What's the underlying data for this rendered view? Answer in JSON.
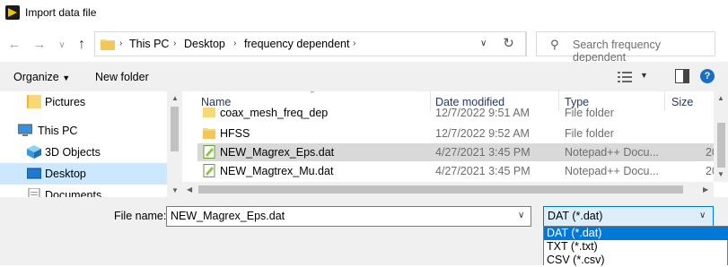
{
  "window": {
    "title": "Import data file"
  },
  "nav": {
    "breadcrumbs": [
      "This PC",
      "Desktop",
      "frequency dependent"
    ],
    "search_placeholder": "Search frequency dependent"
  },
  "toolbar": {
    "organize_label": "Organize",
    "new_folder_label": "New folder"
  },
  "sidebar": {
    "items": [
      {
        "label": "Pictures",
        "icon": "folder-icon"
      },
      {
        "label": "This PC",
        "icon": "computer-icon"
      },
      {
        "label": "3D Objects",
        "icon": "cube-icon"
      },
      {
        "label": "Desktop",
        "icon": "desktop-icon",
        "selected": true
      },
      {
        "label": "Documents",
        "icon": "documents-icon"
      }
    ]
  },
  "filelist": {
    "columns": [
      "Name",
      "Date modified",
      "Type",
      "Size"
    ],
    "rows": [
      {
        "name": "coax_mesh_freq_dep",
        "date": "12/7/2022 9:51 AM",
        "type": "File folder",
        "size": "",
        "icon": "folder-icon"
      },
      {
        "name": "HFSS",
        "date": "12/7/2022 9:52 AM",
        "type": "File folder",
        "size": "",
        "icon": "folder-icon"
      },
      {
        "name": "NEW_Magrex_Eps.dat",
        "date": "4/27/2021 3:45 PM",
        "type": "Notepad++ Docu...",
        "size": "20",
        "icon": "notepad-file-icon",
        "selected": true
      },
      {
        "name": "NEW_Magtrex_Mu.dat",
        "date": "4/27/2021 3:45 PM",
        "type": "Notepad++ Docu...",
        "size": "20",
        "icon": "notepad-file-icon"
      }
    ]
  },
  "bottom": {
    "file_name_label": "File name:",
    "file_name_value": "NEW_Magrex_Eps.dat",
    "file_type_value": "DAT (*.dat)",
    "file_type_options": [
      "DAT (*.dat)",
      "TXT (*.txt)",
      "CSV (*.csv)"
    ]
  },
  "colors": {
    "selection": "#cce8ff",
    "accent": "#0078d7",
    "folder": "#f8d775"
  }
}
